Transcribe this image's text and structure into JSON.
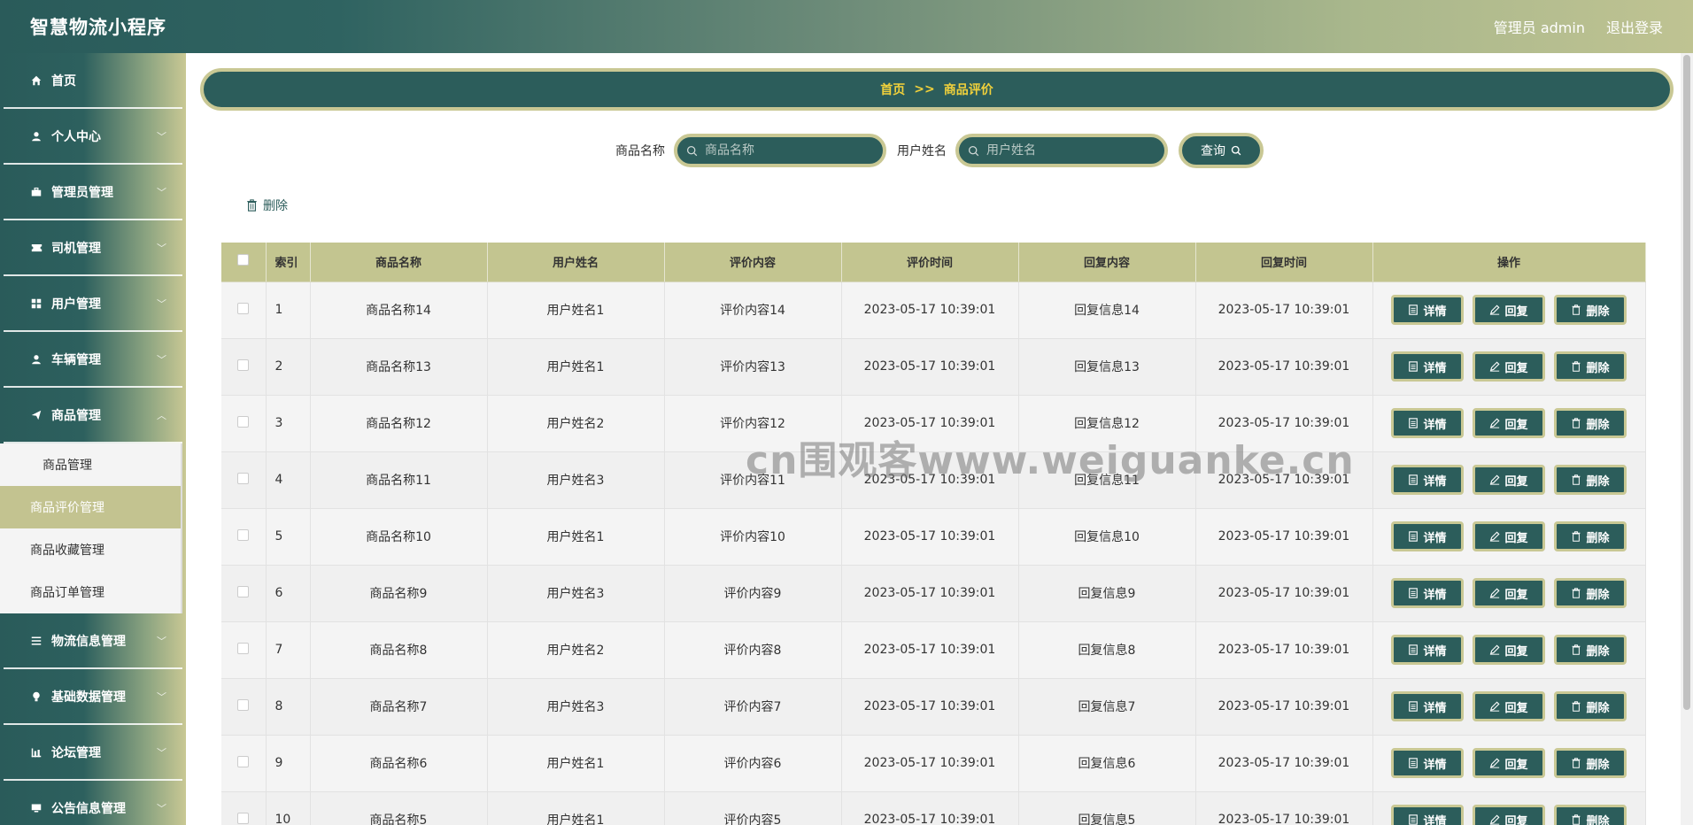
{
  "app": {
    "title": "智慧物流小程序"
  },
  "topbar": {
    "user": "管理员 admin",
    "logout": "退出登录"
  },
  "sidebar": {
    "items": [
      {
        "label": "首页",
        "icon": "home-icon",
        "chev": false
      },
      {
        "label": "个人中心",
        "icon": "user-icon",
        "chev": true
      },
      {
        "label": "管理员管理",
        "icon": "briefcase-icon",
        "chev": true
      },
      {
        "label": "司机管理",
        "icon": "ticket-icon",
        "chev": true
      },
      {
        "label": "用户管理",
        "icon": "grid-icon",
        "chev": true
      },
      {
        "label": "车辆管理",
        "icon": "user-icon",
        "chev": true
      },
      {
        "label": "商品管理",
        "icon": "send-icon",
        "chev": true,
        "expanded": true
      },
      {
        "label": "物流信息管理",
        "icon": "list-icon",
        "chev": true
      },
      {
        "label": "基础数据管理",
        "icon": "bulb-icon",
        "chev": true
      },
      {
        "label": "论坛管理",
        "icon": "chart-icon",
        "chev": true
      },
      {
        "label": "公告信息管理",
        "icon": "monitor-icon",
        "chev": true
      }
    ],
    "submenu": [
      "商品管理",
      "商品评价管理",
      "商品收藏管理",
      "商品订单管理"
    ],
    "active_sub": "商品评价管理"
  },
  "breadcrumb": {
    "home": "首页",
    "sep": ">>",
    "current": "商品评价"
  },
  "search": {
    "label1": "商品名称",
    "placeholder1": "商品名称",
    "label2": "用户姓名",
    "placeholder2": "用户姓名",
    "button": "查询"
  },
  "actions": {
    "delete": "删除"
  },
  "table": {
    "headers": [
      "索引",
      "商品名称",
      "用户姓名",
      "评价内容",
      "评价时间",
      "回复内容",
      "回复时间",
      "操作"
    ],
    "buttons": {
      "detail": "详情",
      "reply": "回复",
      "delete": "删除"
    },
    "rows": [
      [
        "1",
        "商品名称14",
        "用户姓名1",
        "评价内容14",
        "2023-05-17 10:39:01",
        "回复信息14",
        "2023-05-17 10:39:01"
      ],
      [
        "2",
        "商品名称13",
        "用户姓名1",
        "评价内容13",
        "2023-05-17 10:39:01",
        "回复信息13",
        "2023-05-17 10:39:01"
      ],
      [
        "3",
        "商品名称12",
        "用户姓名2",
        "评价内容12",
        "2023-05-17 10:39:01",
        "回复信息12",
        "2023-05-17 10:39:01"
      ],
      [
        "4",
        "商品名称11",
        "用户姓名3",
        "评价内容11",
        "2023-05-17 10:39:01",
        "回复信息11",
        "2023-05-17 10:39:01"
      ],
      [
        "5",
        "商品名称10",
        "用户姓名1",
        "评价内容10",
        "2023-05-17 10:39:01",
        "回复信息10",
        "2023-05-17 10:39:01"
      ],
      [
        "6",
        "商品名称9",
        "用户姓名3",
        "评价内容9",
        "2023-05-17 10:39:01",
        "回复信息9",
        "2023-05-17 10:39:01"
      ],
      [
        "7",
        "商品名称8",
        "用户姓名2",
        "评价内容8",
        "2023-05-17 10:39:01",
        "回复信息8",
        "2023-05-17 10:39:01"
      ],
      [
        "8",
        "商品名称7",
        "用户姓名3",
        "评价内容7",
        "2023-05-17 10:39:01",
        "回复信息7",
        "2023-05-17 10:39:01"
      ],
      [
        "9",
        "商品名称6",
        "用户姓名1",
        "评价内容6",
        "2023-05-17 10:39:01",
        "回复信息6",
        "2023-05-17 10:39:01"
      ],
      [
        "10",
        "商品名称5",
        "用户姓名1",
        "评价内容5",
        "2023-05-17 10:39:01",
        "回复信息5",
        "2023-05-17 10:39:01"
      ]
    ]
  },
  "watermark": "cn围观客www.weiguanke.cn",
  "colors": {
    "primary": "#2c5d5b",
    "accent": "#c9c894",
    "breadcrumb_text": "#f1d13b"
  }
}
